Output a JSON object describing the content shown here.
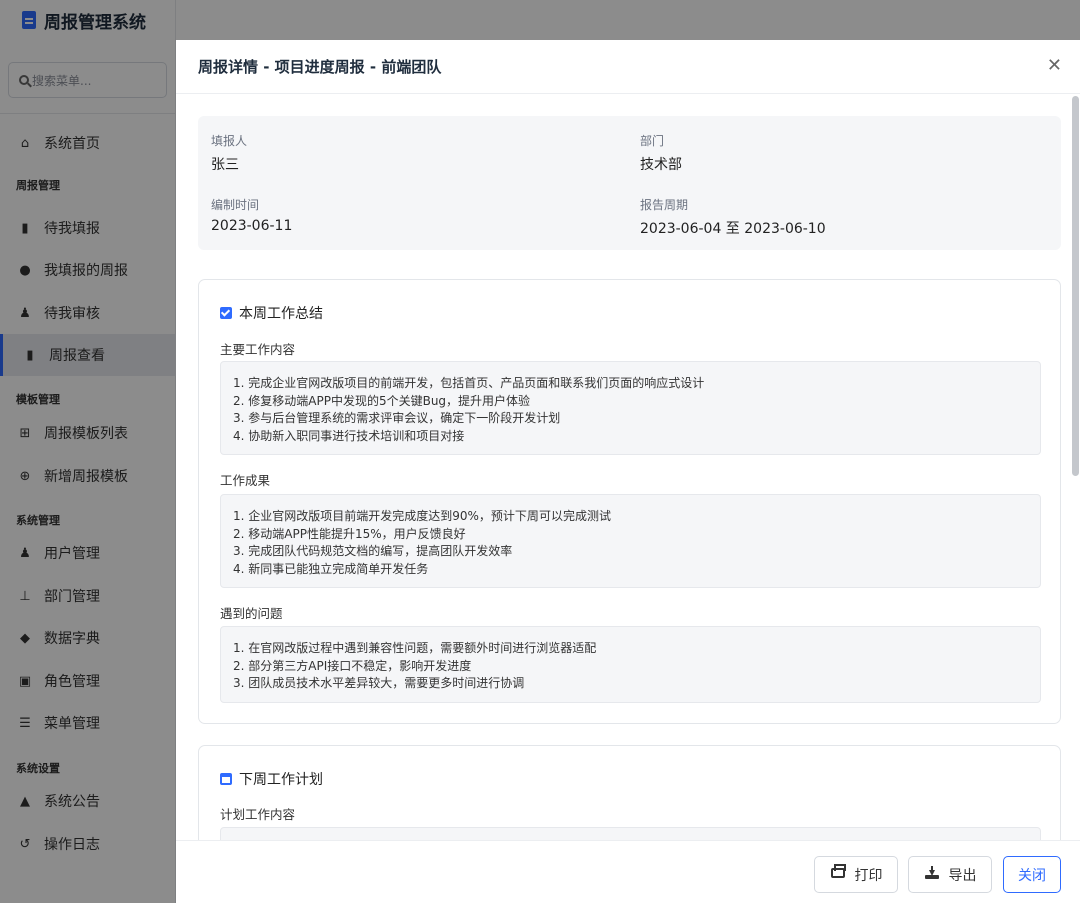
{
  "app": {
    "title": "周报管理系统",
    "search_placeholder": "搜索菜单..."
  },
  "sidebar": {
    "home": "系统首页",
    "groups": {
      "report": "周报管理",
      "template": "模板管理",
      "system": "系统管理",
      "settings": "系统设置"
    },
    "items": {
      "todo_fill": "待我填报",
      "my_reports": "我填报的周报",
      "todo_review": "待我审核",
      "report_view": "周报查看",
      "template_list": "周报模板列表",
      "template_add": "新增周报模板",
      "users": "用户管理",
      "departments": "部门管理",
      "dictionary": "数据字典",
      "roles": "角色管理",
      "menus": "菜单管理",
      "notices": "系统公告",
      "logs": "操作日志"
    }
  },
  "drawer": {
    "title": "周报详情 - 项目进度周报 - 前端团队",
    "close_symbol": "✕",
    "info": {
      "reporter_label": "填报人",
      "reporter": "张三",
      "dept_label": "部门",
      "dept": "技术部",
      "time_label": "编制时间",
      "time": "2023-06-11",
      "period_label": "报告周期",
      "period": "2023-06-04 至 2023-06-10"
    },
    "summary": {
      "title": "本周工作总结",
      "main_label": "主要工作内容",
      "main": [
        "1. 完成企业官网改版项目的前端开发，包括首页、产品页面和联系我们页面的响应式设计",
        "2. 修复移动端APP中发现的5个关键Bug，提升用户体验",
        "3. 参与后台管理系统的需求评审会议，确定下一阶段开发计划",
        "4. 协助新入职同事进行技术培训和项目对接"
      ],
      "result_label": "工作成果",
      "result": [
        "1. 企业官网改版项目前端开发完成度达到90%，预计下周可以完成测试",
        "2. 移动端APP性能提升15%，用户反馈良好",
        "3. 完成团队代码规范文档的编写，提高团队开发效率",
        "4. 新同事已能独立完成简单开发任务"
      ],
      "issue_label": "遇到的问题",
      "issue": [
        "1. 在官网改版过程中遇到兼容性问题，需要额外时间进行浏览器适配",
        "2. 部分第三方API接口不稳定，影响开发进度",
        "3. 团队成员技术水平差异较大，需要更多时间进行协调"
      ]
    },
    "plan": {
      "title": "下周工作计划",
      "plan_label": "计划工作内容"
    },
    "footer": {
      "print": "打印",
      "export": "导出",
      "close": "关闭"
    }
  }
}
